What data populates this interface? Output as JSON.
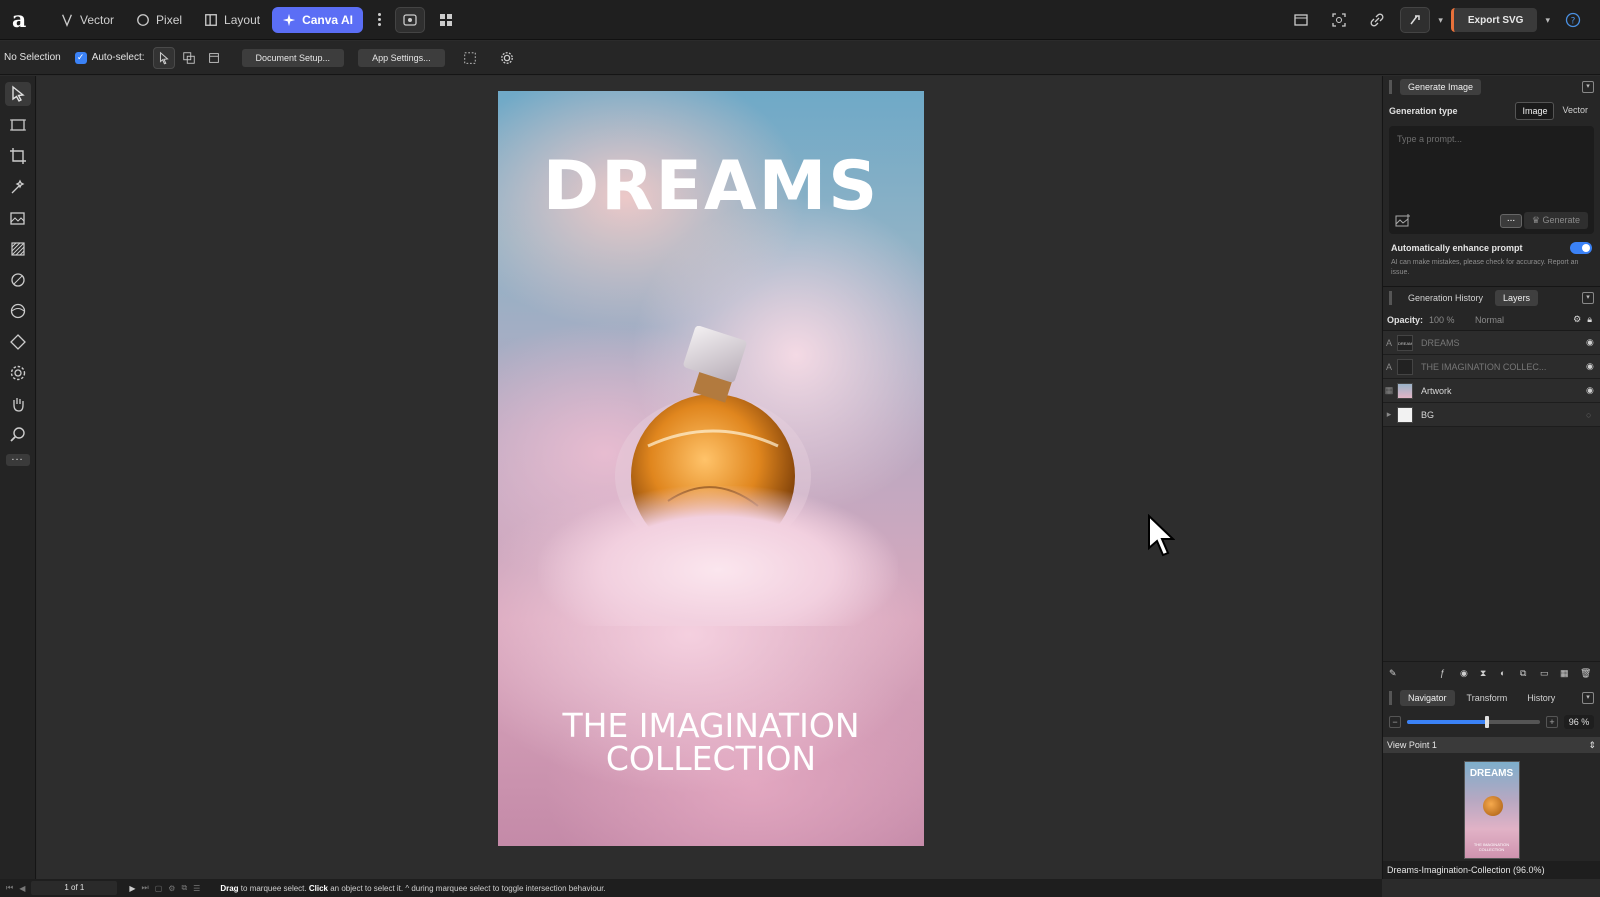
{
  "topbar": {
    "personas": [
      {
        "label": "Vector",
        "icon": "vector-pen-icon"
      },
      {
        "label": "Pixel",
        "icon": "pixel-brush-icon"
      },
      {
        "label": "Layout",
        "icon": "layout-grid-icon"
      },
      {
        "label": "Canva AI",
        "icon": "sparkle-icon",
        "active": true
      }
    ],
    "export_label": "Export SVG"
  },
  "context": {
    "selection": "No Selection",
    "auto_select": "Auto-select:",
    "document_setup": "Document Setup...",
    "app_settings": "App Settings..."
  },
  "artboard": {
    "title": "DREAMS",
    "subtitle_line1": "THE IMAGINATION",
    "subtitle_line2": "COLLECTION"
  },
  "generate": {
    "header": "Generate Image",
    "type_label": "Generation type",
    "type_options": [
      "Image",
      "Vector"
    ],
    "prompt_placeholder": "Type a prompt...",
    "generate_btn": "Generate",
    "enhance_label": "Automatically enhance prompt",
    "disclaimer": "AI can make mistakes, please check for accuracy. Report an issue."
  },
  "layers_panel": {
    "tabs": [
      "Generation History",
      "Layers"
    ],
    "opacity_label": "Opacity:",
    "opacity_value": "100 %",
    "blend_mode": "Normal",
    "layers": [
      {
        "name": "DREAMS",
        "type": "A",
        "visible": true,
        "dim": true,
        "thumb": "DREAMS"
      },
      {
        "name": "THE IMAGINATION COLLEC...",
        "type": "A",
        "visible": true,
        "dim": true,
        "thumb": ""
      },
      {
        "name": "Artwork",
        "type": "img",
        "visible": true,
        "dim": false,
        "thumb": ""
      },
      {
        "name": "BG",
        "type": "rect",
        "visible": false,
        "dim": false,
        "thumb": ""
      }
    ]
  },
  "navigator": {
    "tabs": [
      "Navigator",
      "Transform",
      "History"
    ],
    "zoom": "96 %",
    "zoom_level": 0.6,
    "viewpoint": "View Point 1",
    "thumb_title": "DREAMS",
    "thumb_sub": "THE IMAGINATION COLLECTION"
  },
  "status": {
    "page": "1 of 1",
    "hint_drag": "Drag",
    "hint_1": " to marquee select. ",
    "hint_click": "Click",
    "hint_2": " an object to select it. ^ during marquee select to toggle intersection behaviour."
  },
  "file": {
    "name": "Dreams-Imagination-Collection (96.0%)"
  },
  "colors": {
    "accent": "#5b6ef5",
    "toggle": "#3b82f6",
    "export_mark": "#e8713a"
  }
}
